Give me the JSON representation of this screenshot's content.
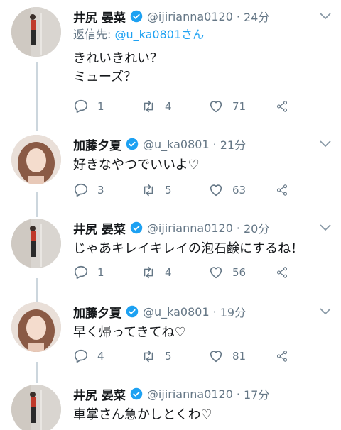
{
  "tweets": [
    {
      "name": "井尻 晏菜",
      "handle": "@ijirianna0120",
      "time": "24分",
      "reply_prefix": "返信先: ",
      "reply_mention": "@u_ka0801さん",
      "text": "きれいきれい？\nミューズ？",
      "replies": "1",
      "retweets": "4",
      "likes": "71"
    },
    {
      "name": "加藤夕夏",
      "handle": "@u_ka0801",
      "time": "21分",
      "text": "好きなやつでいいよ♡",
      "replies": "3",
      "retweets": "5",
      "likes": "63"
    },
    {
      "name": "井尻 晏菜",
      "handle": "@ijirianna0120",
      "time": "20分",
      "text": "じゃあキレイキレイの泡石鹸にするね！",
      "replies": "1",
      "retweets": "4",
      "likes": "56"
    },
    {
      "name": "加藤夕夏",
      "handle": "@u_ka0801",
      "time": "19分",
      "text": "早く帰ってきてね♡",
      "replies": "4",
      "retweets": "5",
      "likes": "81"
    },
    {
      "name": "井尻 晏菜",
      "handle": "@ijirianna0120",
      "time": "17分",
      "text": "車掌さん急かしとくわ♡"
    }
  ],
  "separator": "·",
  "colors": {
    "accent": "#1da1f2",
    "muted": "#657786",
    "line": "#ccd6dd"
  }
}
